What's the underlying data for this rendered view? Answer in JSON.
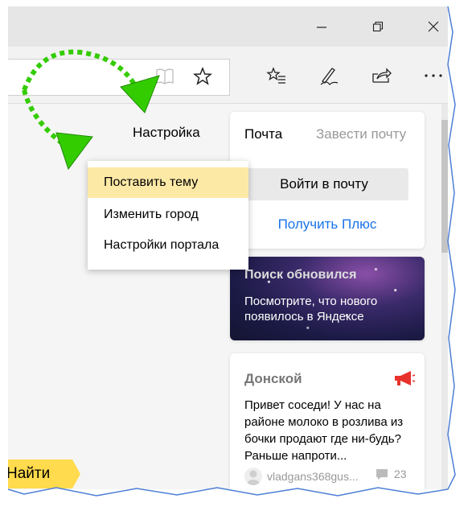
{
  "nav": {
    "settings_link": "Настройка"
  },
  "settings_menu": {
    "items": [
      {
        "label": "Поставить тему",
        "active": true
      },
      {
        "label": "Изменить город",
        "active": false
      },
      {
        "label": "Настройки портала",
        "active": false
      }
    ]
  },
  "mail_card": {
    "title": "Почта",
    "create_link": "Завести почту",
    "login_button": "Войти в почту",
    "plus_link": "Получить Плюс"
  },
  "news_card": {
    "title": "Поиск обновился",
    "text": "Посмотрите, что нового появилось в Яндексе"
  },
  "district_card": {
    "title": "Донской",
    "text": "Привет соседи! У нас на районе молоко в розлива из бочки продают где ни-будь? Раньше напроти...",
    "username": "vladgans368gus...",
    "comments": "23"
  },
  "search": {
    "button_label": "Найти"
  },
  "colors": {
    "accent_yellow": "#ffdb4d",
    "menu_highlight": "#fde9a6",
    "link_blue": "#1a73e8",
    "arrow_green": "#33cc00",
    "megaphone_red": "#e8322c"
  }
}
